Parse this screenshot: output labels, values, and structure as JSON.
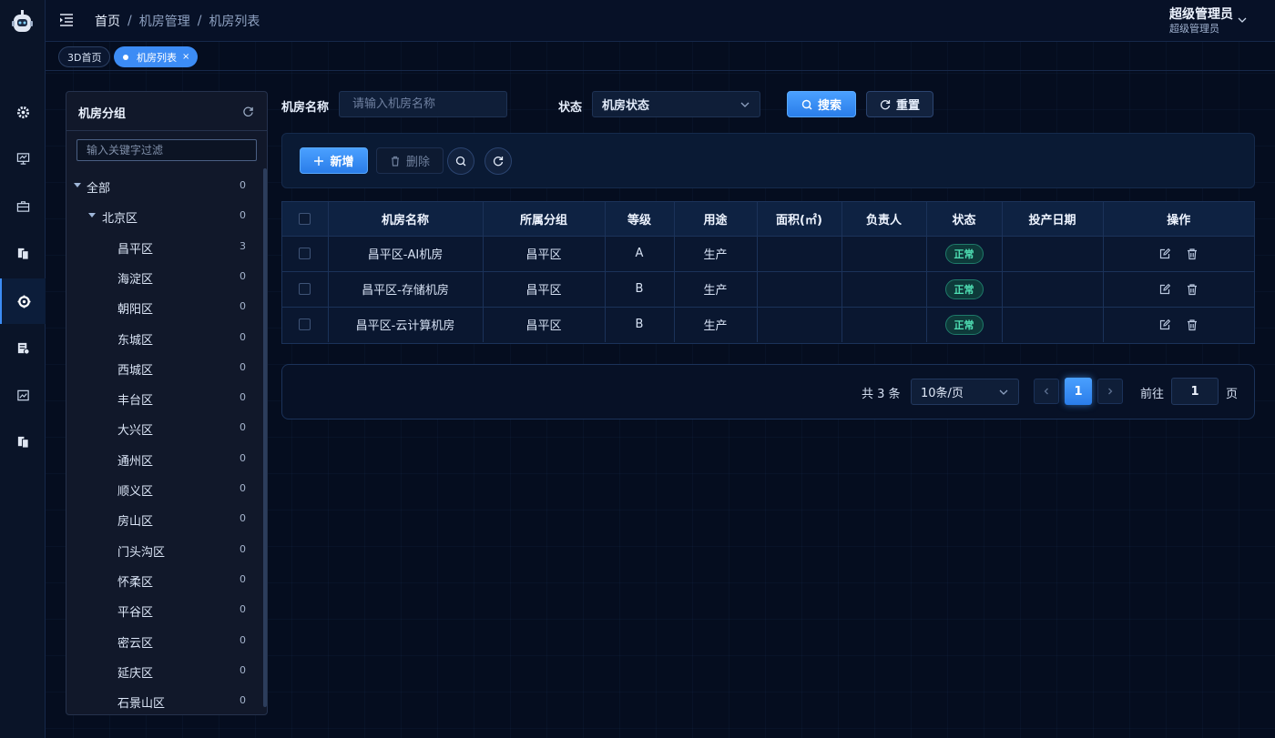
{
  "header": {
    "breadcrumbs": [
      "首页",
      "机房管理",
      "机房列表"
    ],
    "user_name": "超级管理员",
    "user_role": "超级管理员"
  },
  "tabs": [
    {
      "label": "3D首页",
      "active": false
    },
    {
      "label": "机房列表",
      "active": true,
      "close": "×"
    }
  ],
  "rail": {
    "icons": [
      "gear-icon",
      "monitor-icon",
      "toolbox-icon",
      "documents-icon",
      "target-icon",
      "server-doc-icon",
      "image-icon",
      "copy-icon"
    ],
    "active_index": 4
  },
  "tree": {
    "title": "机房分组",
    "filter_placeholder": "输入关键字过滤",
    "nodes": [
      {
        "label": "全部",
        "count": "0",
        "level": 0,
        "expanded": true
      },
      {
        "label": "北京区",
        "count": "0",
        "level": 1,
        "expanded": true
      },
      {
        "label": "昌平区",
        "count": "3",
        "level": 2
      },
      {
        "label": "海淀区",
        "count": "0",
        "level": 2
      },
      {
        "label": "朝阳区",
        "count": "0",
        "level": 2
      },
      {
        "label": "东城区",
        "count": "0",
        "level": 2
      },
      {
        "label": "西城区",
        "count": "0",
        "level": 2
      },
      {
        "label": "丰台区",
        "count": "0",
        "level": 2
      },
      {
        "label": "大兴区",
        "count": "0",
        "level": 2
      },
      {
        "label": "通州区",
        "count": "0",
        "level": 2
      },
      {
        "label": "顺义区",
        "count": "0",
        "level": 2
      },
      {
        "label": "房山区",
        "count": "0",
        "level": 2
      },
      {
        "label": "门头沟区",
        "count": "0",
        "level": 2
      },
      {
        "label": "怀柔区",
        "count": "0",
        "level": 2
      },
      {
        "label": "平谷区",
        "count": "0",
        "level": 2
      },
      {
        "label": "密云区",
        "count": "0",
        "level": 2
      },
      {
        "label": "延庆区",
        "count": "0",
        "level": 2
      },
      {
        "label": "石景山区",
        "count": "0",
        "level": 2
      }
    ]
  },
  "search": {
    "name_label": "机房名称",
    "name_placeholder": "请输入机房名称",
    "status_label": "状态",
    "status_select": "机房状态",
    "search_button": "搜索",
    "reset_button": "重置"
  },
  "toolbar": {
    "add_button": "新增",
    "delete_button": "删除"
  },
  "table": {
    "columns": [
      "",
      "机房名称",
      "所属分组",
      "等级",
      "用途",
      "面积(㎡)",
      "负责人",
      "状态",
      "投产日期",
      "操作"
    ],
    "rows": [
      {
        "name": "昌平区-AI机房",
        "group": "昌平区",
        "level": "A",
        "usage": "生产",
        "area": "",
        "owner": "",
        "status": "正常",
        "date": ""
      },
      {
        "name": "昌平区-存储机房",
        "group": "昌平区",
        "level": "B",
        "usage": "生产",
        "area": "",
        "owner": "",
        "status": "正常",
        "date": ""
      },
      {
        "name": "昌平区-云计算机房",
        "group": "昌平区",
        "level": "B",
        "usage": "生产",
        "area": "",
        "owner": "",
        "status": "正常",
        "date": ""
      }
    ]
  },
  "pagination": {
    "total_text": "共 3 条",
    "page_size": "10条/页",
    "current_page": "1",
    "goto_label": "前往",
    "goto_value": "1",
    "page_unit": "页"
  },
  "colors": {
    "background": "#050d1f",
    "accent": "#3c8cf5",
    "status_ok": "#4fe0b4"
  }
}
